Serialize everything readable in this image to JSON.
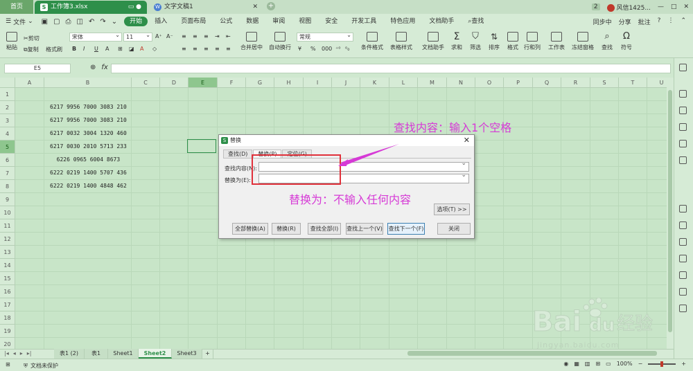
{
  "titlebar": {
    "home_tab": "首页",
    "active_doc": "工作簿3.xlsx",
    "inactive_doc": "文字文稿1",
    "right_badge": "2",
    "user": "风信1425...",
    "window_controls": [
      "—",
      "□",
      "✕"
    ]
  },
  "menu": {
    "file": "文件",
    "items": [
      "开始",
      "插入",
      "页面布局",
      "公式",
      "数据",
      "审阅",
      "视图",
      "安全",
      "开发工具",
      "特色应用",
      "文档助手"
    ],
    "search": "查找",
    "right": [
      "同步中",
      "分享",
      "批注"
    ]
  },
  "ribbon": {
    "paste": "粘贴",
    "cut": "剪切",
    "copy": "复制",
    "format_painter": "格式刷",
    "font_name": "宋体",
    "font_size": "11",
    "merge_center": "合并居中",
    "wrap": "自动换行",
    "number_format": "常规",
    "cond_format": "条件格式",
    "table_style": "表格样式",
    "doc_helper": "文档助手",
    "sum": "求和",
    "filter": "筛选",
    "sort": "排序",
    "format": "格式",
    "rows_cols": "行和列",
    "worksheet": "工作表",
    "freeze": "冻结窗格",
    "find": "查找",
    "symbol": "符号"
  },
  "formula_bar": {
    "name_box": "E5",
    "fx": "fx"
  },
  "grid": {
    "columns": [
      "A",
      "B",
      "C",
      "D",
      "E",
      "F",
      "G",
      "H",
      "I",
      "J",
      "K",
      "L",
      "M",
      "N",
      "O",
      "P",
      "Q",
      "R",
      "S",
      "T",
      "U"
    ],
    "selected_column": "E",
    "rows": [
      "1",
      "2",
      "3",
      "4",
      "5",
      "6",
      "7",
      "8",
      "9",
      "10",
      "11",
      "12",
      "13",
      "14",
      "15",
      "16",
      "17",
      "18",
      "19",
      "20"
    ],
    "selected_row": "5",
    "b_values": [
      "",
      "6217 9956 7000 3083 210",
      "6217 9956 7000 3083 210",
      "6217 0032 3004 1320 460",
      "6217 0030 2010 5713 233",
      "  6226 0965 6004 8673",
      "6222 0219 1400 5707 436",
      "6222 0219 1400 4848 462"
    ]
  },
  "sheets": {
    "tabs": [
      "表1 (2)",
      "表1",
      "Sheet1",
      "Sheet2",
      "Sheet3"
    ],
    "active": "Sheet2",
    "add": "+"
  },
  "status": {
    "protect": "文档未保护",
    "zoom": "100%"
  },
  "dialog": {
    "title": "替换",
    "tabs": [
      "查找(D)",
      "替换(P)",
      "定位(G)"
    ],
    "active_tab": "替换(P)",
    "find_label": "查找内容(N):",
    "find_value": "",
    "replace_label": "替换为(E):",
    "replace_value": "",
    "options_btn": "选项(T) >>",
    "buttons": [
      "全部替换(A)",
      "替换(R)",
      "查找全部(I)",
      "查找上一个(V)",
      "查找下一个(F)",
      "关闭"
    ]
  },
  "annotations": {
    "top": "查找内容：输入1个空格",
    "bottom": "替换为：不输入任何内容"
  },
  "watermark": {
    "brand": "Bai",
    "brand2": "du",
    "suffix": "经验",
    "url": "jingyan.baidu.com"
  },
  "colors": {
    "accent": "#2e8f4a",
    "annotation": "#d63ad6",
    "highlight_box": "#e0303a"
  }
}
